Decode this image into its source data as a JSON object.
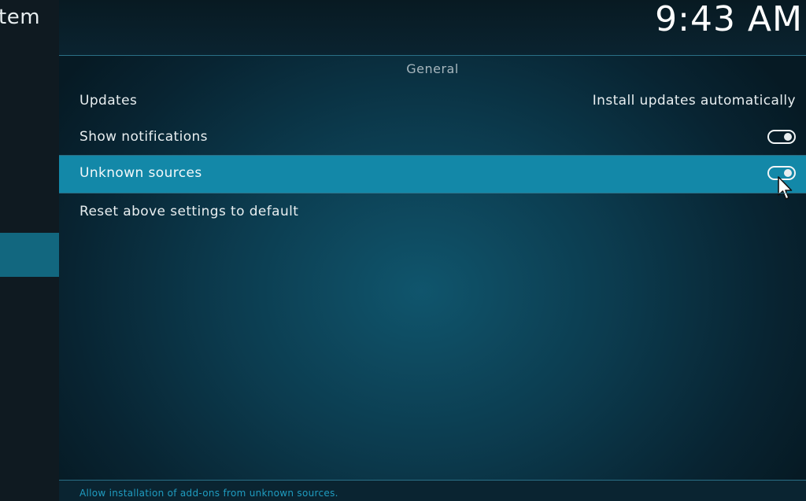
{
  "sidebar": {
    "title": "tem"
  },
  "header": {
    "clock": "9:43 AM"
  },
  "section": {
    "title": "General"
  },
  "settings": [
    {
      "label": "Updates",
      "value": "Install updates automatically"
    },
    {
      "label": "Show notifications",
      "toggle": "on"
    },
    {
      "label": "Unknown sources",
      "toggle": "on",
      "focused": true
    },
    {
      "label": "Reset above settings to default"
    }
  ],
  "footer": {
    "help_text": "Allow installation of add-ons from unknown sources."
  },
  "colors": {
    "focus_highlight": "#1388a8",
    "help_text": "#1f9cc0",
    "text": "#e8eef0"
  },
  "icons": {
    "toggle": "toggle-switch-icon",
    "cursor": "mouse-pointer-icon"
  }
}
